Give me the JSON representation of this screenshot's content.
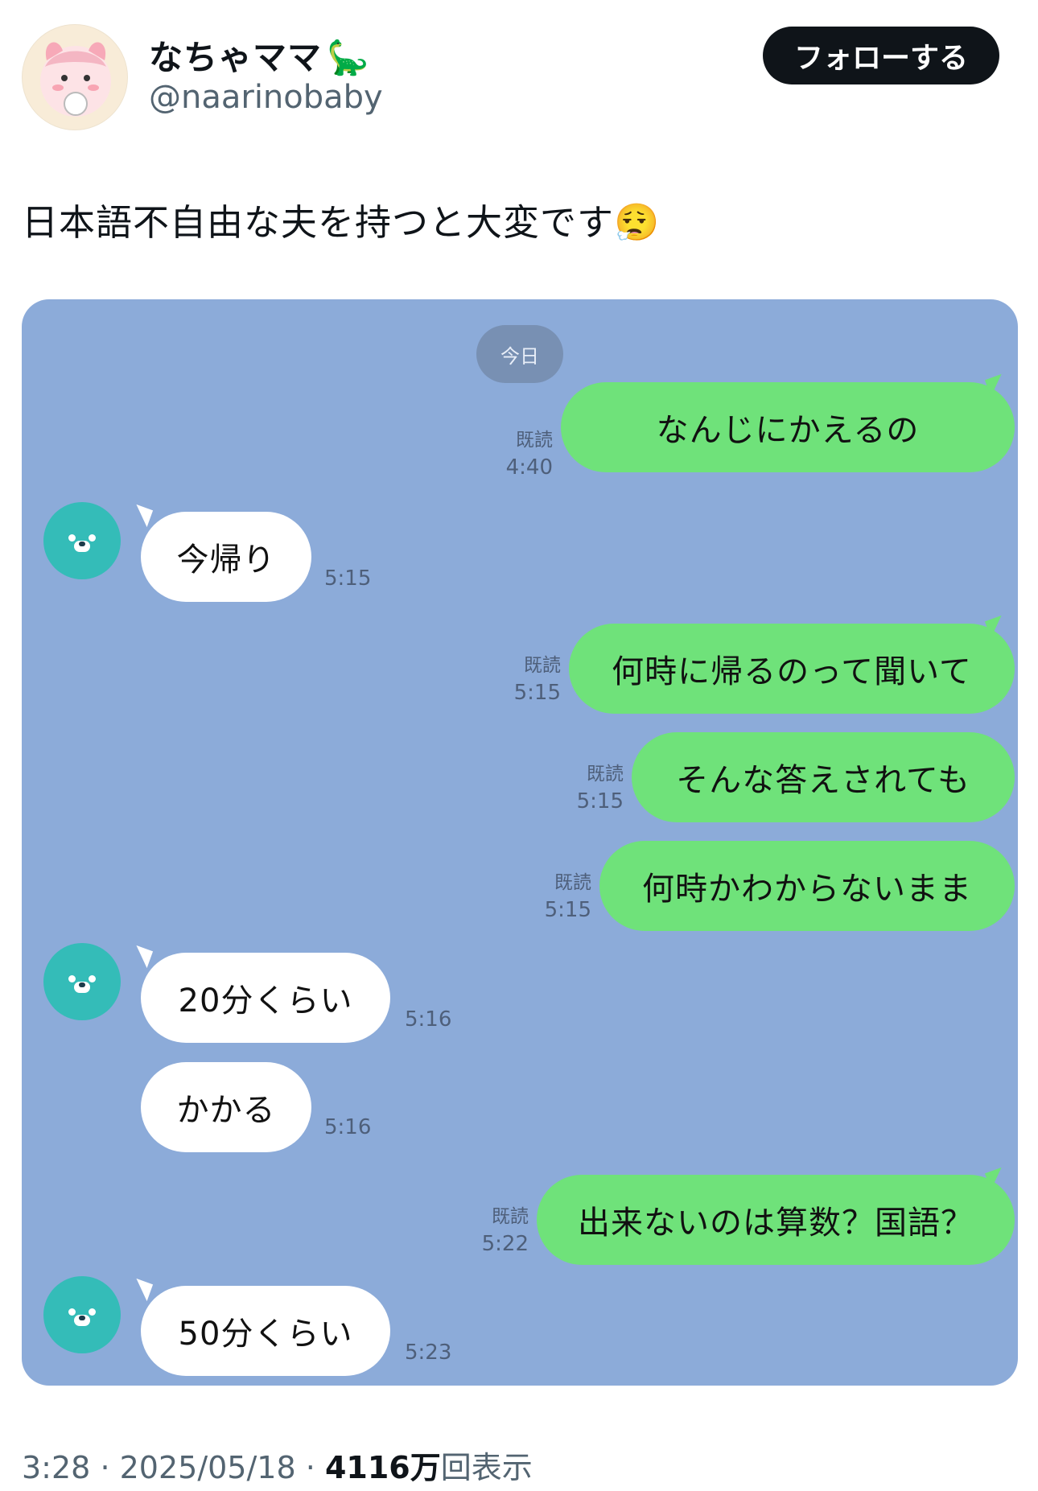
{
  "author": {
    "display_name": "なちゃママ",
    "name_emoji": "🦕",
    "handle": "@naarinobaby",
    "follow_label": "フォローする"
  },
  "tweet": {
    "text": "日本語不自由な夫を持つと大変です",
    "emoji": "😮‍💨"
  },
  "chat": {
    "day_label": "今日",
    "read_label": "既読",
    "messages": [
      {
        "side": "out",
        "text": "なんじにかえるの",
        "time": "4:40"
      },
      {
        "side": "in",
        "text": "今帰り",
        "time": "5:15"
      },
      {
        "side": "out",
        "text": "何時に帰るのって聞いて",
        "time": "5:15"
      },
      {
        "side": "out",
        "text": "そんな答えされても",
        "time": "5:15"
      },
      {
        "side": "out",
        "text": "何時かわからないまま",
        "time": "5:15"
      },
      {
        "side": "in",
        "text": "20分くらい",
        "time": "5:16"
      },
      {
        "side": "in",
        "text": "かかる",
        "time": "5:16"
      },
      {
        "side": "out",
        "text": "出来ないのは算数？国語？",
        "time": "5:22"
      },
      {
        "side": "in",
        "text": "50分くらい",
        "time": "5:23"
      }
    ]
  },
  "footer": {
    "time": "3:28",
    "separator": "·",
    "date": "2025/05/18",
    "views_number": "4116",
    "views_unit": "万",
    "views_suffix": "回表示"
  },
  "colors": {
    "chat_background": "#8cabd9",
    "outgoing_bubble": "#6fe27a",
    "incoming_bubble": "#ffffff",
    "friend_avatar": "#34bcb8",
    "follow_button": "#0f1419"
  }
}
